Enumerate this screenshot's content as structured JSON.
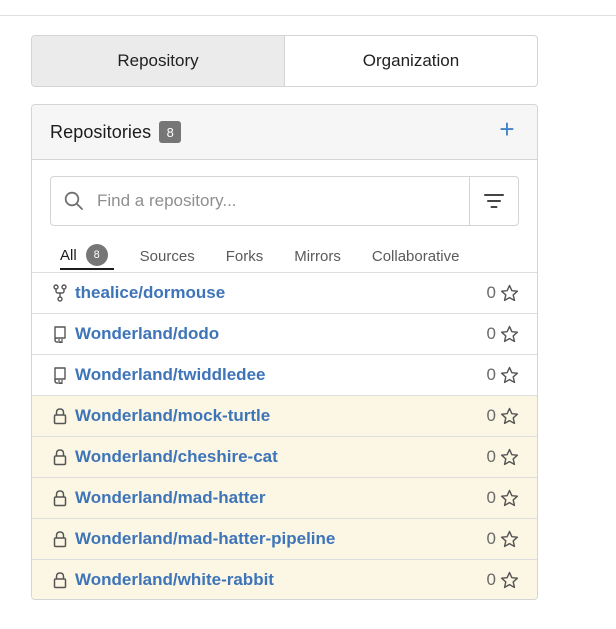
{
  "toggle": {
    "repository_label": "Repository",
    "organization_label": "Organization"
  },
  "panel": {
    "title": "Repositories",
    "count": "8",
    "add_label": "+"
  },
  "search": {
    "placeholder": "Find a repository..."
  },
  "tabs": [
    {
      "label": "All",
      "count": "8"
    },
    {
      "label": "Sources"
    },
    {
      "label": "Forks"
    },
    {
      "label": "Mirrors"
    },
    {
      "label": "Collaborative"
    }
  ],
  "repos": [
    {
      "name": "thealice/dormouse",
      "stars": "0",
      "icon": "fork-icon",
      "private": false
    },
    {
      "name": "Wonderland/dodo",
      "stars": "0",
      "icon": "repo-icon",
      "private": false
    },
    {
      "name": "Wonderland/twiddledee",
      "stars": "0",
      "icon": "repo-icon",
      "private": false
    },
    {
      "name": "Wonderland/mock-turtle",
      "stars": "0",
      "icon": "lock-icon",
      "private": true
    },
    {
      "name": "Wonderland/cheshire-cat",
      "stars": "0",
      "icon": "lock-icon",
      "private": true
    },
    {
      "name": "Wonderland/mad-hatter",
      "stars": "0",
      "icon": "lock-icon",
      "private": true
    },
    {
      "name": "Wonderland/mad-hatter-pipeline",
      "stars": "0",
      "icon": "lock-icon",
      "private": true
    },
    {
      "name": "Wonderland/white-rabbit",
      "stars": "0",
      "icon": "lock-icon",
      "private": true
    }
  ],
  "colors": {
    "link": "#3e74b8",
    "private_row_bg": "#fbf7e4",
    "add_button": "#4183c4",
    "badge": "#767676"
  }
}
